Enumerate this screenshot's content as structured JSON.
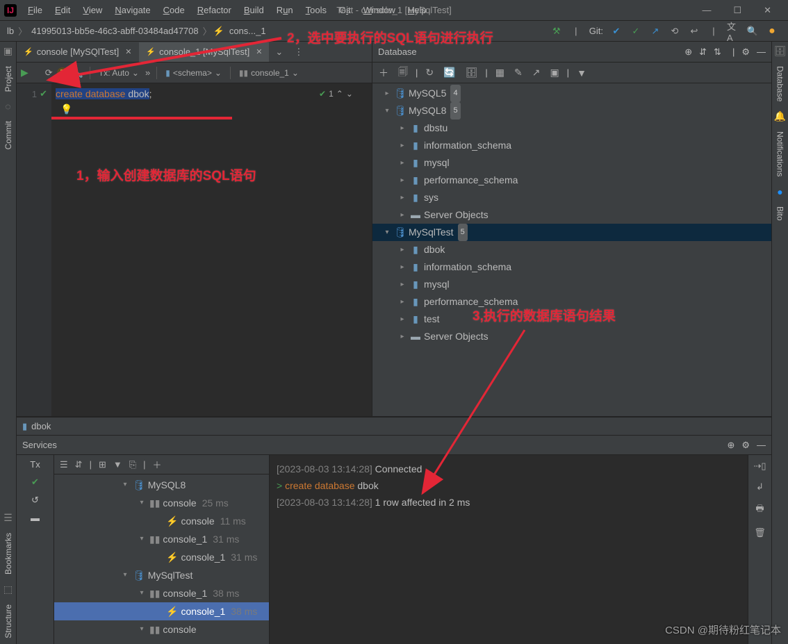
{
  "window": {
    "title": "Test - console_1 [MySqlTest]",
    "menus": [
      "File",
      "Edit",
      "View",
      "Navigate",
      "Code",
      "Refactor",
      "Build",
      "Run",
      "Tools",
      "Git",
      "Window",
      "Help"
    ]
  },
  "nav": {
    "crumb1": "lb",
    "crumb2": "41995013-bb5e-46c3-abff-03484ad47708",
    "crumb3": "cons..._1",
    "git_label": "Git:"
  },
  "editor": {
    "tabs": [
      {
        "label": "console [MySQlTest]",
        "active": false
      },
      {
        "label": "console_1 [MySqlTest]",
        "active": true
      }
    ],
    "toolbar": {
      "tx": "Tx: Auto",
      "schema": "<schema>",
      "target": "console_1"
    },
    "line_no": "1",
    "code_keyword1": "create",
    "code_keyword2": "database",
    "code_ident": "dbok",
    "code_end": ";",
    "marker_text": "1",
    "sub_tab": "dbok"
  },
  "database": {
    "title": "Database",
    "tree": [
      {
        "lvl": 0,
        "tw": "▸",
        "ic": "db",
        "text": "MySQL5",
        "badge": "4"
      },
      {
        "lvl": 0,
        "tw": "▾",
        "ic": "db",
        "text": "MySQL8",
        "badge": "5"
      },
      {
        "lvl": 1,
        "tw": "▸",
        "ic": "schema",
        "text": "dbstu"
      },
      {
        "lvl": 1,
        "tw": "▸",
        "ic": "schema",
        "text": "information_schema"
      },
      {
        "lvl": 1,
        "tw": "▸",
        "ic": "schema",
        "text": "mysql"
      },
      {
        "lvl": 1,
        "tw": "▸",
        "ic": "schema",
        "text": "performance_schema"
      },
      {
        "lvl": 1,
        "tw": "▸",
        "ic": "schema",
        "text": "sys"
      },
      {
        "lvl": 1,
        "tw": "▸",
        "ic": "folder",
        "text": "Server Objects"
      },
      {
        "lvl": 0,
        "tw": "▾",
        "ic": "db",
        "text": "MySqlTest",
        "badge": "5",
        "sel": true
      },
      {
        "lvl": 1,
        "tw": "▸",
        "ic": "schema",
        "text": "dbok"
      },
      {
        "lvl": 1,
        "tw": "▸",
        "ic": "schema",
        "text": "information_schema"
      },
      {
        "lvl": 1,
        "tw": "▸",
        "ic": "schema",
        "text": "mysql"
      },
      {
        "lvl": 1,
        "tw": "▸",
        "ic": "schema",
        "text": "performance_schema"
      },
      {
        "lvl": 1,
        "tw": "▸",
        "ic": "schema",
        "text": "test"
      },
      {
        "lvl": 1,
        "tw": "▸",
        "ic": "folder",
        "text": "Server Objects"
      }
    ]
  },
  "services": {
    "title": "Services",
    "tree": [
      {
        "ind": 0,
        "tw": "▾",
        "ic": "db",
        "text": "MySQL8"
      },
      {
        "ind": 1,
        "tw": "▾",
        "ic": "con",
        "text": "console",
        "time": "25 ms"
      },
      {
        "ind": 2,
        "tw": "",
        "ic": "q",
        "text": "console",
        "time": "11 ms"
      },
      {
        "ind": 1,
        "tw": "▾",
        "ic": "con",
        "text": "console_1",
        "time": "31 ms"
      },
      {
        "ind": 2,
        "tw": "",
        "ic": "q",
        "text": "console_1",
        "time": "31 ms"
      },
      {
        "ind": 0,
        "tw": "▾",
        "ic": "db",
        "text": "MySqlTest"
      },
      {
        "ind": 1,
        "tw": "▾",
        "ic": "con",
        "text": "console_1",
        "time": "38 ms"
      },
      {
        "ind": 2,
        "tw": "",
        "ic": "q",
        "text": "console_1",
        "time": "38 ms",
        "sel": true
      },
      {
        "ind": 1,
        "tw": "▾",
        "ic": "con",
        "text": "console"
      }
    ],
    "output": {
      "l1_ts": "[2023-08-03 13:14:28]",
      "l1_text": " Connected",
      "l2_prompt": "> ",
      "l2_kw1": "create",
      "l2_kw2": "database",
      "l2_id": "dbok",
      "l3_ts": "[2023-08-03 13:14:28]",
      "l3_text": " 1 row affected in 2 ms"
    }
  },
  "annotations": {
    "a1": "1，输入创建数据库的SQL语句",
    "a2": "2，选中要执行的SQL语句进行执行",
    "a3": "3,执行的数据库语句结果"
  },
  "left_strip": [
    "Project",
    "Commit",
    "Bookmarks",
    "Structure"
  ],
  "right_strip": [
    "Database",
    "Notifications",
    "Bito"
  ],
  "watermark": "CSDN @期待粉红笔记本"
}
